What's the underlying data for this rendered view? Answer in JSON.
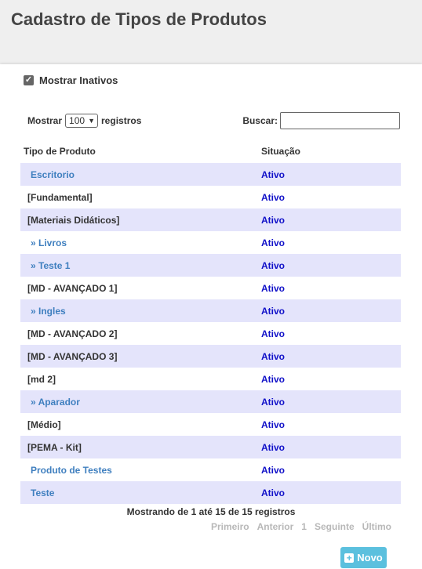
{
  "page": {
    "title": "Cadastro de Tipos de Produtos"
  },
  "filters": {
    "show_inactive_label": "Mostrar Inativos",
    "show_inactive_checked": true
  },
  "length": {
    "prefix": "Mostrar",
    "value": "100",
    "suffix": "registros"
  },
  "search": {
    "label": "Buscar:",
    "value": ""
  },
  "table": {
    "headers": {
      "type": "Tipo de Produto",
      "status": "Situação"
    },
    "rows": [
      {
        "type": "Escritorio",
        "status": "Ativo",
        "style": "link"
      },
      {
        "type": "[Fundamental]",
        "status": "Ativo",
        "style": "plain"
      },
      {
        "type": "[Materiais Didáticos]",
        "status": "Ativo",
        "style": "plain"
      },
      {
        "type": "» Livros",
        "status": "Ativo",
        "style": "link"
      },
      {
        "type": "» Teste 1",
        "status": "Ativo",
        "style": "link"
      },
      {
        "type": "[MD - AVANÇADO 1]",
        "status": "Ativo",
        "style": "plain"
      },
      {
        "type": "» Ingles",
        "status": "Ativo",
        "style": "link"
      },
      {
        "type": "[MD - AVANÇADO 2]",
        "status": "Ativo",
        "style": "plain"
      },
      {
        "type": "[MD - AVANÇADO 3]",
        "status": "Ativo",
        "style": "plain"
      },
      {
        "type": "[md 2]",
        "status": "Ativo",
        "style": "plain"
      },
      {
        "type": "» Aparador",
        "status": "Ativo",
        "style": "link"
      },
      {
        "type": "[Médio]",
        "status": "Ativo",
        "style": "plain"
      },
      {
        "type": "[PEMA - Kit]",
        "status": "Ativo",
        "style": "plain"
      },
      {
        "type": "Produto de Testes",
        "status": "Ativo",
        "style": "link"
      },
      {
        "type": "Teste",
        "status": "Ativo",
        "style": "link"
      }
    ]
  },
  "info": "Mostrando de 1 até 15 de 15 registros",
  "pagination": {
    "first": "Primeiro",
    "previous": "Anterior",
    "page": "1",
    "next": "Seguinte",
    "last": "Último"
  },
  "actions": {
    "new_label": "Novo"
  },
  "colors": {
    "accent": "#5bc0de",
    "row_stripe": "#e4e4fb",
    "link": "#3f7fbf",
    "status": "#1010c8"
  }
}
